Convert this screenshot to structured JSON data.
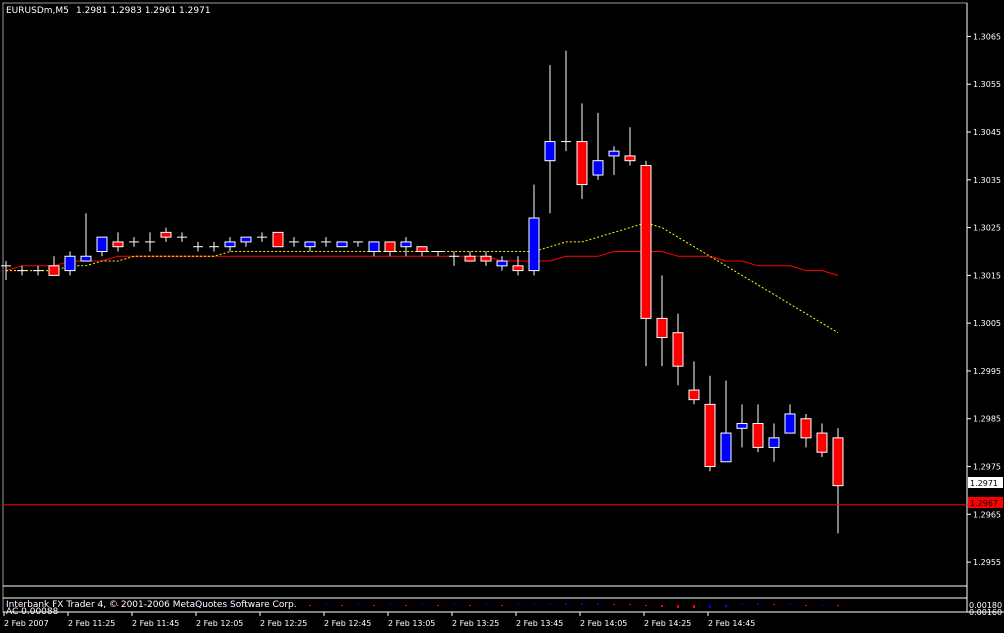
{
  "header": {
    "symbol": "EURUSDm,M5",
    "ohlc": "1.2981 1.2983 1.2961 1.2971"
  },
  "footer": {
    "copyright": "Interbank FX Trader 4, © 2001-2006 MetaQuotes Software Corp.",
    "indicator_label": "AC 0.00088",
    "subwindow_scale_top": "0.00180",
    "subwindow_scale_bottom": "0.00160"
  },
  "price_tags": {
    "current": "1.2971",
    "line": "1.2967"
  },
  "colors": {
    "background": "#000000",
    "axis": "#ffffff",
    "bull": "#0000ff",
    "bear": "#ff0000",
    "wick": "#ffffff",
    "ma_slow": "#ff0000",
    "ma_fast": "#ffff00",
    "hline": "#ff0000"
  },
  "chart_data": {
    "type": "candlestick",
    "timeframe": "M5",
    "ylim": [
      1.295,
      1.3072
    ],
    "y_ticks": [
      "1.3065",
      "1.3055",
      "1.3045",
      "1.3035",
      "1.3025",
      "1.3015",
      "1.3005",
      "1.2995",
      "1.2985",
      "1.2975",
      "1.2965",
      "1.2955"
    ],
    "x_tick_labels": [
      "2 Feb 2007",
      "2 Feb 11:25",
      "2 Feb 11:45",
      "2 Feb 12:05",
      "2 Feb 12:25",
      "2 Feb 12:45",
      "2 Feb 13:05",
      "2 Feb 13:25",
      "2 Feb 13:45",
      "2 Feb 14:05",
      "2 Feb 14:25",
      "2 Feb 14:45"
    ],
    "horizontal_line": 1.2967,
    "candles": [
      {
        "o": 1.3017,
        "h": 1.3018,
        "l": 1.3014,
        "c": 1.3017
      },
      {
        "o": 1.3016,
        "h": 1.3017,
        "l": 1.3015,
        "c": 1.3016
      },
      {
        "o": 1.3016,
        "h": 1.3017,
        "l": 1.3015,
        "c": 1.3016
      },
      {
        "o": 1.3017,
        "h": 1.3019,
        "l": 1.3015,
        "c": 1.3015
      },
      {
        "o": 1.3016,
        "h": 1.302,
        "l": 1.3015,
        "c": 1.3019
      },
      {
        "o": 1.3018,
        "h": 1.3028,
        "l": 1.3018,
        "c": 1.3019
      },
      {
        "o": 1.302,
        "h": 1.3023,
        "l": 1.3019,
        "c": 1.3023
      },
      {
        "o": 1.3022,
        "h": 1.3024,
        "l": 1.302,
        "c": 1.3021
      },
      {
        "o": 1.3022,
        "h": 1.3023,
        "l": 1.3021,
        "c": 1.3022
      },
      {
        "o": 1.3022,
        "h": 1.3024,
        "l": 1.302,
        "c": 1.3022
      },
      {
        "o": 1.3024,
        "h": 1.3025,
        "l": 1.3022,
        "c": 1.3023
      },
      {
        "o": 1.3023,
        "h": 1.3024,
        "l": 1.3022,
        "c": 1.3023
      },
      {
        "o": 1.3021,
        "h": 1.3022,
        "l": 1.302,
        "c": 1.3021
      },
      {
        "o": 1.3021,
        "h": 1.3022,
        "l": 1.302,
        "c": 1.3021
      },
      {
        "o": 1.3021,
        "h": 1.3023,
        "l": 1.302,
        "c": 1.3022
      },
      {
        "o": 1.3022,
        "h": 1.3023,
        "l": 1.3021,
        "c": 1.3023
      },
      {
        "o": 1.3023,
        "h": 1.3024,
        "l": 1.3022,
        "c": 1.3023
      },
      {
        "o": 1.3024,
        "h": 1.3024,
        "l": 1.3021,
        "c": 1.3021
      },
      {
        "o": 1.3022,
        "h": 1.3023,
        "l": 1.3021,
        "c": 1.3022
      },
      {
        "o": 1.3021,
        "h": 1.3022,
        "l": 1.302,
        "c": 1.3022
      },
      {
        "o": 1.3022,
        "h": 1.3023,
        "l": 1.3021,
        "c": 1.3022
      },
      {
        "o": 1.3021,
        "h": 1.3022,
        "l": 1.3021,
        "c": 1.3022
      },
      {
        "o": 1.3022,
        "h": 1.3022,
        "l": 1.3021,
        "c": 1.3022
      },
      {
        "o": 1.302,
        "h": 1.3022,
        "l": 1.3019,
        "c": 1.3022
      },
      {
        "o": 1.3022,
        "h": 1.3022,
        "l": 1.3019,
        "c": 1.302
      },
      {
        "o": 1.3021,
        "h": 1.3023,
        "l": 1.3019,
        "c": 1.3022
      },
      {
        "o": 1.3021,
        "h": 1.3021,
        "l": 1.3019,
        "c": 1.302
      },
      {
        "o": 1.302,
        "h": 1.302,
        "l": 1.3019,
        "c": 1.302
      },
      {
        "o": 1.3019,
        "h": 1.302,
        "l": 1.3017,
        "c": 1.3019
      },
      {
        "o": 1.3019,
        "h": 1.302,
        "l": 1.3018,
        "c": 1.3018
      },
      {
        "o": 1.3019,
        "h": 1.302,
        "l": 1.3017,
        "c": 1.3018
      },
      {
        "o": 1.3017,
        "h": 1.3019,
        "l": 1.3016,
        "c": 1.3018
      },
      {
        "o": 1.3017,
        "h": 1.3019,
        "l": 1.3015,
        "c": 1.3016
      },
      {
        "o": 1.3016,
        "h": 1.3034,
        "l": 1.3015,
        "c": 1.3027
      },
      {
        "o": 1.3039,
        "h": 1.3059,
        "l": 1.3028,
        "c": 1.3043
      },
      {
        "o": 1.3043,
        "h": 1.3062,
        "l": 1.3041,
        "c": 1.3043
      },
      {
        "o": 1.3043,
        "h": 1.3051,
        "l": 1.3031,
        "c": 1.3034
      },
      {
        "o": 1.3036,
        "h": 1.3049,
        "l": 1.3035,
        "c": 1.3039
      },
      {
        "o": 1.304,
        "h": 1.3042,
        "l": 1.3036,
        "c": 1.3041
      },
      {
        "o": 1.304,
        "h": 1.3046,
        "l": 1.3038,
        "c": 1.3039
      },
      {
        "o": 1.3038,
        "h": 1.3039,
        "l": 1.2996,
        "c": 1.3006
      },
      {
        "o": 1.3006,
        "h": 1.3015,
        "l": 1.2996,
        "c": 1.3002
      },
      {
        "o": 1.3003,
        "h": 1.3007,
        "l": 1.2992,
        "c": 1.2996
      },
      {
        "o": 1.2991,
        "h": 1.2997,
        "l": 1.2988,
        "c": 1.2989
      },
      {
        "o": 1.2988,
        "h": 1.2994,
        "l": 1.2974,
        "c": 1.2975
      },
      {
        "o": 1.2976,
        "h": 1.2993,
        "l": 1.2976,
        "c": 1.2982
      },
      {
        "o": 1.2983,
        "h": 1.2988,
        "l": 1.2979,
        "c": 1.2984
      },
      {
        "o": 1.2984,
        "h": 1.2988,
        "l": 1.2978,
        "c": 1.2979
      },
      {
        "o": 1.2979,
        "h": 1.2984,
        "l": 1.2976,
        "c": 1.2981
      },
      {
        "o": 1.2982,
        "h": 1.2988,
        "l": 1.2982,
        "c": 1.2986
      },
      {
        "o": 1.2985,
        "h": 1.2986,
        "l": 1.2979,
        "c": 1.2981
      },
      {
        "o": 1.2982,
        "h": 1.2984,
        "l": 1.2977,
        "c": 1.2978
      },
      {
        "o": 1.2981,
        "h": 1.2983,
        "l": 1.2961,
        "c": 1.2971
      }
    ],
    "ma_slow": [
      1.3016,
      1.3017,
      1.3017,
      1.3017,
      1.3018,
      1.3018,
      1.3018,
      1.3019,
      1.3019,
      1.3019,
      1.3019,
      1.3019,
      1.3019,
      1.3019,
      1.3019,
      1.3019,
      1.3019,
      1.3019,
      1.3019,
      1.3019,
      1.3019,
      1.3019,
      1.3019,
      1.3019,
      1.3019,
      1.3019,
      1.3019,
      1.3019,
      1.3019,
      1.3019,
      1.3019,
      1.3018,
      1.3018,
      1.3018,
      1.3018,
      1.3019,
      1.3019,
      1.3019,
      1.302,
      1.302,
      1.302,
      1.302,
      1.3019,
      1.3019,
      1.3019,
      1.3018,
      1.3018,
      1.3017,
      1.3017,
      1.3017,
      1.3016,
      1.3016,
      1.3015
    ],
    "ma_fast": [
      1.3016,
      1.3016,
      1.3016,
      1.3016,
      1.3017,
      1.3017,
      1.3018,
      1.3018,
      1.3019,
      1.3019,
      1.3019,
      1.3019,
      1.3019,
      1.3019,
      1.302,
      1.302,
      1.302,
      1.302,
      1.302,
      1.302,
      1.302,
      1.302,
      1.302,
      1.302,
      1.302,
      1.302,
      1.302,
      1.302,
      1.302,
      1.302,
      1.302,
      1.302,
      1.302,
      1.302,
      1.3021,
      1.3022,
      1.3022,
      1.3023,
      1.3024,
      1.3025,
      1.3026,
      1.3025,
      1.3023,
      1.3021,
      1.3019,
      1.3017,
      1.3015,
      1.3013,
      1.3011,
      1.3009,
      1.3007,
      1.3005,
      1.3003
    ],
    "ac_histogram": [
      1e-05,
      -1e-05,
      1e-05,
      -1e-05,
      1e-05,
      -1e-05,
      1e-05,
      -1e-05,
      1e-05,
      -1e-05,
      1e-05,
      -1e-05,
      1e-05,
      -1e-05,
      1e-05,
      -1e-05,
      1e-05,
      -1e-05,
      1e-05,
      -1e-05,
      1e-05,
      -1e-05,
      1e-05,
      -1e-05,
      1e-05,
      -1e-05,
      1e-05,
      -1e-05,
      1e-05,
      -1e-05,
      1e-05,
      -1e-05,
      1e-05,
      2e-05,
      3e-05,
      4e-05,
      4e-05,
      4e-05,
      3e-05,
      2e-05,
      -2e-05,
      -5e-05,
      -7e-05,
      -8e-05,
      -8e-05,
      -6e-05,
      3e-05,
      4e-05,
      3e-05,
      3e-05,
      -2e-05,
      -2e-05,
      -3e-05
    ]
  }
}
